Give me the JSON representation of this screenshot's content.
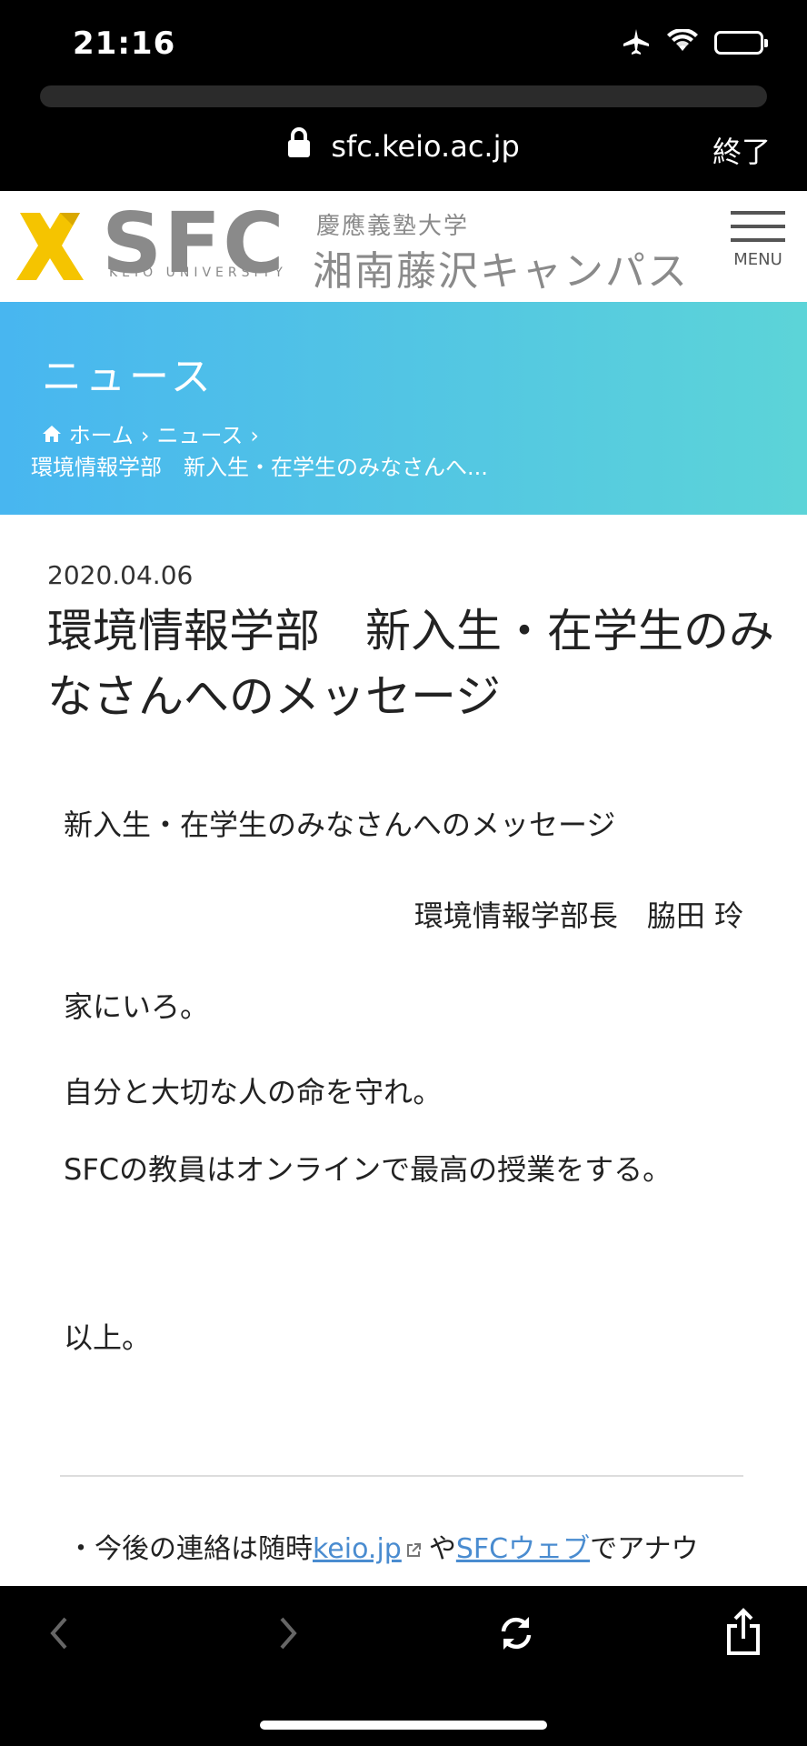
{
  "status": {
    "time": "21:16"
  },
  "browser": {
    "url": "sfc.keio.ac.jp",
    "done_label": "終了"
  },
  "site": {
    "logo_text": "SFC",
    "logo_sub": "KEIO UNIVERSITY",
    "campus_sub": "慶應義塾大学",
    "campus_main": "湘南藤沢キャンパス",
    "menu_label": "MENU",
    "accent": "#f5c400"
  },
  "hero": {
    "title": "ニュース",
    "breadcrumb": {
      "home": "ホーム",
      "news": "ニュース",
      "current": "環境情報学部　新入生・在学生のみなさんへ..."
    }
  },
  "article": {
    "date": "2020.04.06",
    "title": "環境情報学部　新入生・在学生のみなさんへのメッセージ",
    "heading": "新入生・在学生のみなさんへのメッセージ",
    "author": "環境情報学部長　脇田 玲",
    "paragraphs": [
      "家にいろ。",
      "自分と大切な人の命を守れ。",
      "SFCの教員はオンラインで最高の授業をする。",
      "以上。"
    ],
    "note": {
      "prefix": "・今後の連絡は随時",
      "link1": "keio.jp",
      "middle": "や",
      "link2": "SFCウェブ",
      "suffix": "でアナウ"
    }
  }
}
